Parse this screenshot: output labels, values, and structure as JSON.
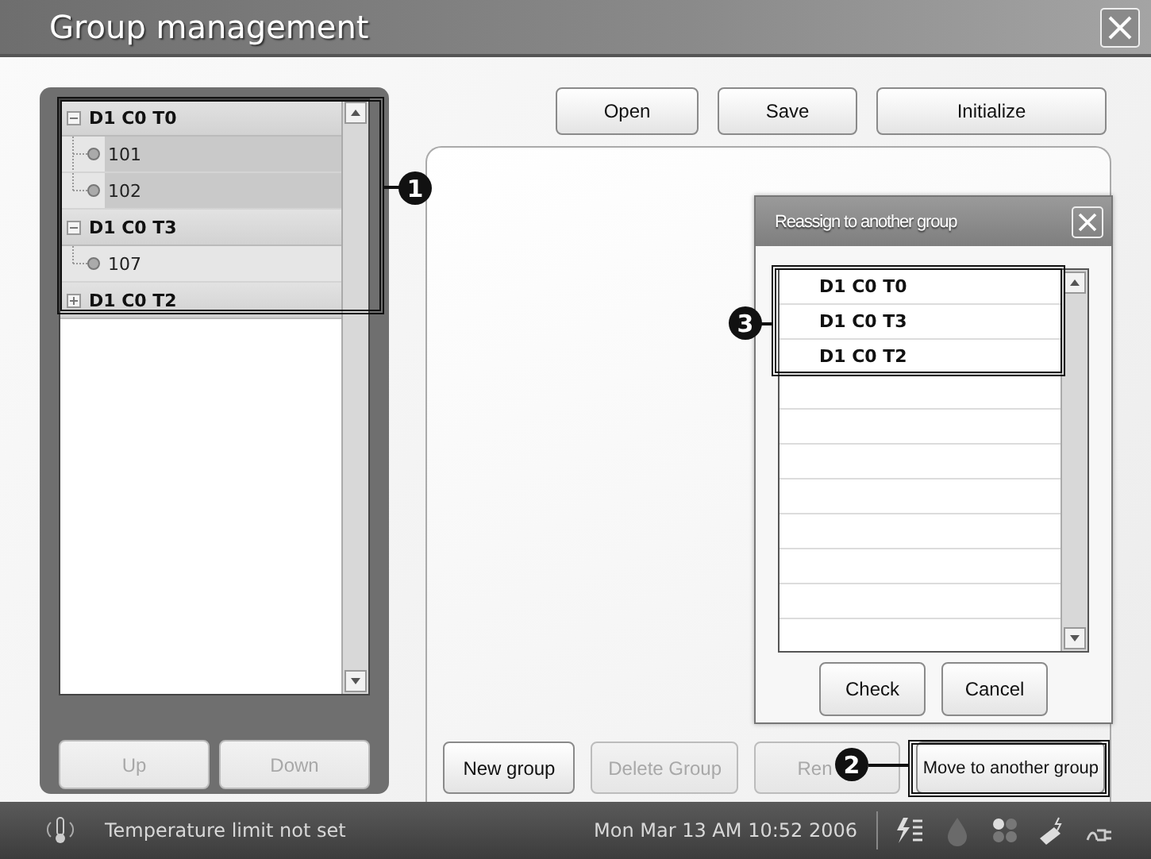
{
  "window": {
    "title": "Group management"
  },
  "tree": [
    {
      "label": "D1 C0 T0",
      "expanded": true,
      "children": [
        {
          "label": "101",
          "selected": true
        },
        {
          "label": "102",
          "selected": true
        }
      ]
    },
    {
      "label": "D1 C0 T3",
      "expanded": true,
      "children": [
        {
          "label": "107",
          "selected": false
        }
      ]
    },
    {
      "label": "D1 C0 T2",
      "expanded": false
    }
  ],
  "list_buttons": [
    {
      "label": "Up",
      "disabled": true
    },
    {
      "label": "Down",
      "disabled": true
    }
  ],
  "toolbar_buttons": [
    {
      "label": "Open",
      "disabled": false
    },
    {
      "label": "Save",
      "disabled": false
    },
    {
      "label": "Initialize",
      "disabled": false
    }
  ],
  "dialog": {
    "title": "Reassign to another group",
    "groups": [
      {
        "label": "D1 C0 T0"
      },
      {
        "label": "D1 C0 T3"
      },
      {
        "label": "D1 C0 T2"
      }
    ],
    "buttons": [
      {
        "label": "Check",
        "disabled": false
      },
      {
        "label": "Cancel",
        "disabled": false
      }
    ]
  },
  "action_buttons": [
    {
      "label": "New group",
      "disabled": false
    },
    {
      "label": "Delete Group",
      "disabled": true
    },
    {
      "label": "Ren",
      "disabled": true
    },
    {
      "label": "Move to another group",
      "disabled": false
    }
  ],
  "callouts": [
    {
      "label": "1"
    },
    {
      "label": "2"
    },
    {
      "label": "3"
    }
  ],
  "status_bar": {
    "message": "Temperature limit not set",
    "datetime": "Mon Mar 13 AM 10:52 2006"
  }
}
